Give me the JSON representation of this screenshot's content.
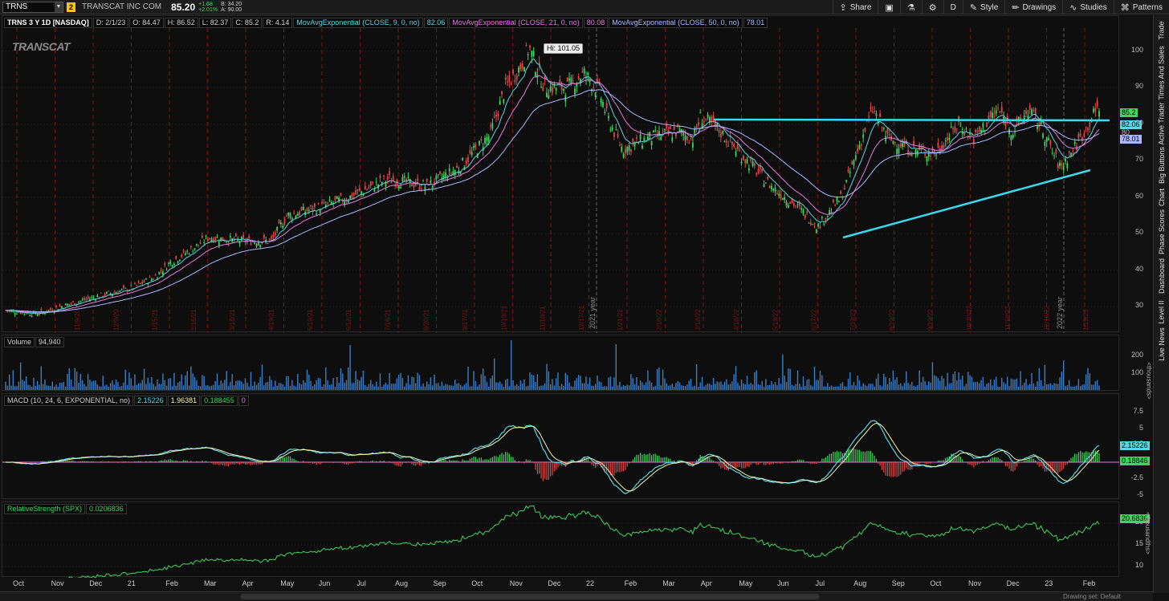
{
  "toolbar": {
    "symbol": "TRNS",
    "link_badge": "2",
    "company": "TRANSCAT INC COM",
    "last": "85.20",
    "change": "+1.68",
    "change_pct": "+2.01%",
    "bid": "B: 34.20",
    "ask": "A: 90.00",
    "buttons": [
      {
        "label": "Share",
        "icon": "share-icon"
      },
      {
        "label": "",
        "icon": "snapshot-icon"
      },
      {
        "label": "",
        "icon": "flask-icon"
      },
      {
        "label": "",
        "icon": "gear-icon"
      },
      {
        "label": "D",
        "icon": ""
      },
      {
        "label": "Style",
        "icon": "style-icon"
      },
      {
        "label": "Drawings",
        "icon": "pencil-icon"
      },
      {
        "label": "Studies",
        "icon": "studies-icon"
      },
      {
        "label": "Patterns",
        "icon": "patterns-icon"
      }
    ]
  },
  "price_panel": {
    "header": "TRNS 3 Y 1D [NASDAQ]",
    "ohlc": [
      "D: 2/1/23",
      "O: 84.47",
      "H: 86.52",
      "L: 82.37",
      "C: 85.2",
      "R: 4.14"
    ],
    "studies": [
      {
        "name": "MovAvgExponential (CLOSE, 9, 0, no)",
        "value": "82.06",
        "color": "#5ad6e6"
      },
      {
        "name": "MovAvgExponential (CLOSE, 21, 0, no)",
        "value": "80.08",
        "color": "#e67ae6"
      },
      {
        "name": "MovAvgExponential (CLOSE, 50, 0, no)",
        "value": "78.01",
        "color": "#a9b8ff"
      }
    ],
    "watermark": "TRANSCAT",
    "hi_label": "Hi: 101.05",
    "y_ticks": [
      "100",
      "90",
      "80",
      "70",
      "60",
      "50",
      "40",
      "30"
    ],
    "tags": [
      {
        "text": "85.2",
        "color": "#3fd65c"
      },
      {
        "text": "82.06",
        "color": "#5ad6e6"
      },
      {
        "text": "80",
        "color": ""
      },
      {
        "text": "78.01",
        "color": "#a9b8ff"
      }
    ],
    "year_labels": [
      "2021 year",
      "2022 year"
    ],
    "date_labels": [
      "11/9/20",
      "12/9/20",
      "1/15/21",
      "2/16/21",
      "3/18/21",
      "4/19/21",
      "5/19/21",
      "6/18/21",
      "7/16/21",
      "8/20/21",
      "9/17/21",
      "10/19/21",
      "11/18/21",
      "12/17/21",
      "1/21/22",
      "2/18/22",
      "3/18/22",
      "4/18/22",
      "5/18/22",
      "6/17/22",
      "7/19/22",
      "8/19/22",
      "9/19/22",
      "10/20/22",
      "11/18/22",
      "12/16/22",
      "1/19/23"
    ]
  },
  "volume_panel": {
    "label": "Volume",
    "value": "94,940",
    "y_ticks": [
      "200",
      "100"
    ],
    "unit": "<thousands>"
  },
  "macd_panel": {
    "label": "MACD (10, 24, 6, EXPONENTIAL, no)",
    "values": [
      "2.15226",
      "1.96381",
      "0.188455",
      "0"
    ],
    "y_ticks": [
      "7.5",
      "5",
      "2.5",
      "-2.5",
      "-5"
    ],
    "tags": [
      {
        "text": "2.15226",
        "color": "#5ad6e6"
      },
      {
        "text": "0.18846",
        "color": "#3fd65c"
      }
    ]
  },
  "rs_panel": {
    "label": "RelativeStrength (SPX)",
    "value": "0.0206836",
    "y_ticks": [
      "20",
      "15",
      "10"
    ],
    "tag": "20.6836",
    "unit": "<thousandths>"
  },
  "x_axis": [
    "Oct",
    "Nov",
    "Dec",
    "21",
    "Feb",
    "Mar",
    "Apr",
    "May",
    "Jun",
    "Jul",
    "Aug",
    "Sep",
    "Oct",
    "Nov",
    "Dec",
    "22",
    "Feb",
    "Mar",
    "Apr",
    "May",
    "Jun",
    "Jul",
    "Aug",
    "Sep",
    "Oct",
    "Nov",
    "Dec",
    "23",
    "Feb"
  ],
  "sidebar": [
    "Trade",
    "Times And Sales",
    "Active Trader",
    "Big Buttons",
    "Chart",
    "Phase Scores",
    "Dashboard",
    "Level II",
    "Live News"
  ],
  "status": "Drawing set: Default",
  "colors": {
    "up": "#3fd65c",
    "down": "#e04848",
    "trendline": "#39d9ee"
  }
}
